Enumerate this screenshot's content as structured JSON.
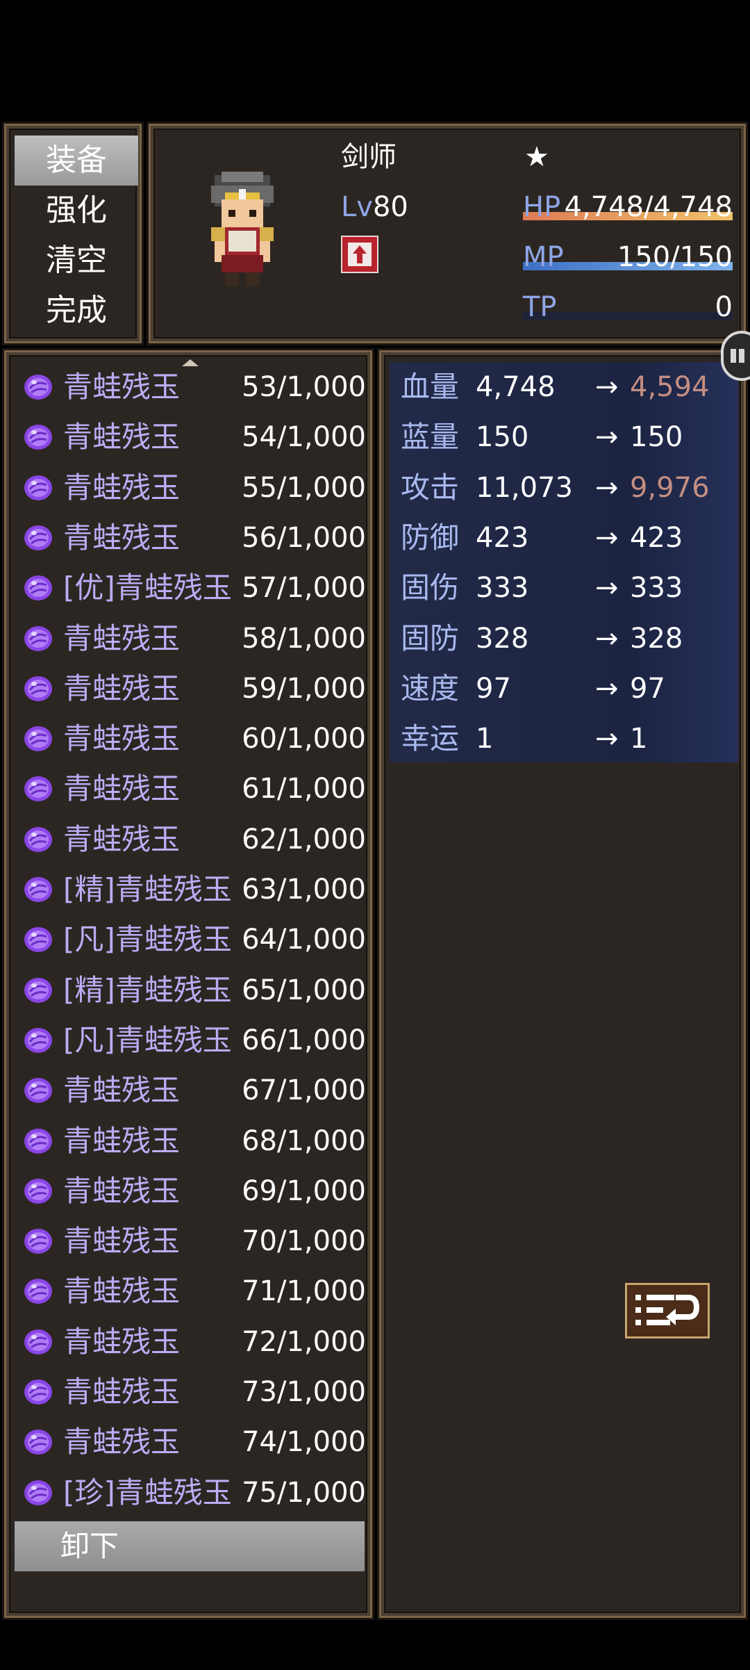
{
  "command_menu": {
    "items": [
      {
        "label": "装备",
        "selected": true
      },
      {
        "label": "强化",
        "selected": false
      },
      {
        "label": "清空",
        "selected": false
      },
      {
        "label": "完成",
        "selected": false
      }
    ]
  },
  "actor": {
    "class_name": "剑师",
    "star": "★",
    "level_label": "Lv",
    "level": "80",
    "hp_label": "HP",
    "hp": "4,748/4,748",
    "mp_label": "MP",
    "mp": "150/150",
    "tp_label": "TP",
    "tp": "0",
    "hp_fill": 1.0,
    "mp_fill": 1.0,
    "tp_fill": 0.0
  },
  "item_list": {
    "items": [
      {
        "name": "青蛙残玉",
        "count": "53/1,000"
      },
      {
        "name": "青蛙残玉",
        "count": "54/1,000"
      },
      {
        "name": "青蛙残玉",
        "count": "55/1,000"
      },
      {
        "name": "青蛙残玉",
        "count": "56/1,000"
      },
      {
        "name": "[优]青蛙残玉",
        "count": "57/1,000"
      },
      {
        "name": "青蛙残玉",
        "count": "58/1,000"
      },
      {
        "name": "青蛙残玉",
        "count": "59/1,000"
      },
      {
        "name": "青蛙残玉",
        "count": "60/1,000"
      },
      {
        "name": "青蛙残玉",
        "count": "61/1,000"
      },
      {
        "name": "青蛙残玉",
        "count": "62/1,000"
      },
      {
        "name": "[精]青蛙残玉",
        "count": "63/1,000"
      },
      {
        "name": "[凡]青蛙残玉",
        "count": "64/1,000"
      },
      {
        "name": "[精]青蛙残玉",
        "count": "65/1,000"
      },
      {
        "name": "[凡]青蛙残玉",
        "count": "66/1,000"
      },
      {
        "name": "青蛙残玉",
        "count": "67/1,000"
      },
      {
        "name": "青蛙残玉",
        "count": "68/1,000"
      },
      {
        "name": "青蛙残玉",
        "count": "69/1,000"
      },
      {
        "name": "青蛙残玉",
        "count": "70/1,000"
      },
      {
        "name": "青蛙残玉",
        "count": "71/1,000"
      },
      {
        "name": "青蛙残玉",
        "count": "72/1,000"
      },
      {
        "name": "青蛙残玉",
        "count": "73/1,000"
      },
      {
        "name": "青蛙残玉",
        "count": "74/1,000"
      },
      {
        "name": "[珍]青蛙残玉",
        "count": "75/1,000"
      }
    ],
    "unequip_label": "卸下"
  },
  "params": {
    "arrow": "→",
    "rows": [
      {
        "name": "血量",
        "current": "4,748",
        "new": "4,594",
        "change": "down"
      },
      {
        "name": "蓝量",
        "current": "150",
        "new": "150",
        "change": "same"
      },
      {
        "name": "攻击",
        "current": "11,073",
        "new": "9,976",
        "change": "down"
      },
      {
        "name": "防御",
        "current": "423",
        "new": "423",
        "change": "same"
      },
      {
        "name": "固伤",
        "current": "333",
        "new": "333",
        "change": "same"
      },
      {
        "name": "固防",
        "current": "328",
        "new": "328",
        "change": "same"
      },
      {
        "name": "速度",
        "current": "97",
        "new": "97",
        "change": "same"
      },
      {
        "name": "幸运",
        "current": "1",
        "new": "1",
        "change": "same"
      }
    ]
  },
  "colors": {
    "item_name": "#b9adf5",
    "stat_down": "#c48e81",
    "frame": "#7a6446"
  }
}
